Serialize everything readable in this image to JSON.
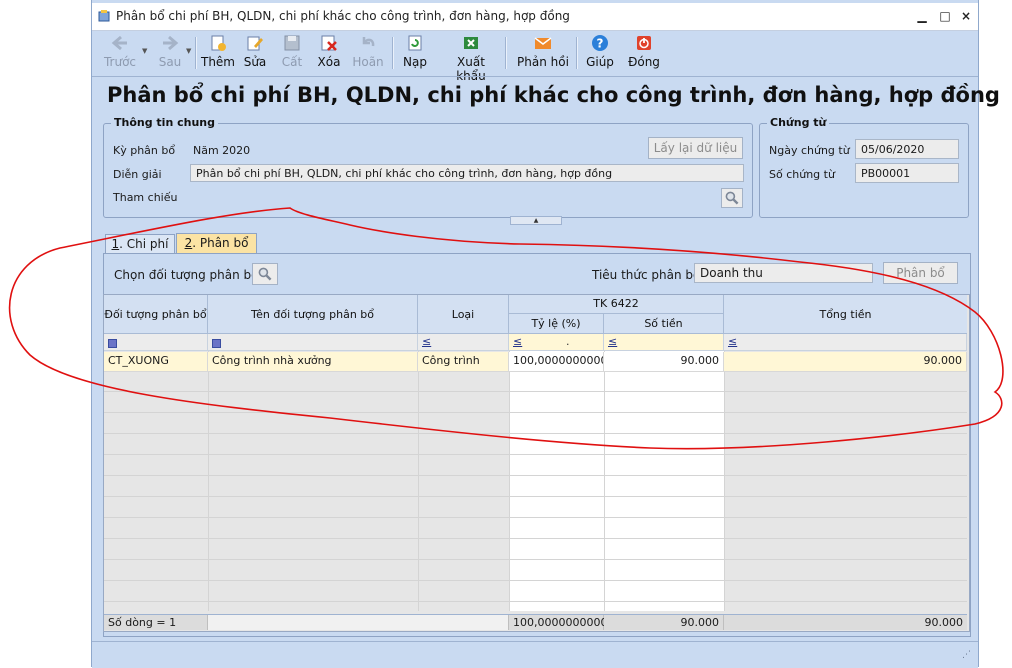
{
  "window": {
    "title": "Phân bổ chi phí BH, QLDN, chi phí khác cho công trình, đơn hàng, hợp đồng"
  },
  "toolbar": {
    "back": "Trước",
    "forward": "Sau",
    "add": "Thêm",
    "edit": "Sửa",
    "save": "Cất",
    "delete": "Xóa",
    "undo": "Hoãn",
    "reload": "Nạp",
    "export": "Xuất khẩu",
    "feedback": "Phản hồi",
    "help": "Giúp",
    "close": "Đóng"
  },
  "page_title": "Phân bổ chi phí BH, QLDN, chi phí khác cho công trình, đơn hàng, hợp đồng",
  "general_info": {
    "group_title": "Thông tin chung",
    "period_label": "Kỳ phân bổ",
    "period_value": "Năm 2020",
    "desc_label": "Diễn giải",
    "desc_value": "Phân bổ chi phí BH, QLDN, chi phí khác cho công trình, đơn hàng, hợp đồng",
    "ref_label": "Tham chiếu",
    "reload_data_button": "Lấy lại dữ liệu"
  },
  "voucher": {
    "group_title": "Chứng từ",
    "date_label": "Ngày chứng từ",
    "date_value": "05/06/2020",
    "number_label": "Số chứng từ",
    "number_value": "PB00001"
  },
  "tabs": [
    {
      "num": "1",
      "label": ". Chi phí"
    },
    {
      "num": "2",
      "label": ". Phân bổ"
    }
  ],
  "allocation": {
    "object_label": "Chọn đối tượng phân bổ",
    "criteria_label": "Tiêu thức phân bổ",
    "criteria_value": "Doanh thu",
    "allocate_button": "Phân bổ"
  },
  "grid": {
    "headers": {
      "object": "Đối tượng phân bổ",
      "object_name": "Tên đối tượng phân bổ",
      "type": "Loại",
      "account": "TK 6422",
      "ratio": "Tỷ lệ (%)",
      "amount": "Số tiền",
      "total": "Tổng tiền"
    },
    "filter_op": "≤",
    "filter_dot": ".",
    "rows": [
      {
        "object": "CT_XUONG",
        "object_name": "Công trình nhà xưởng",
        "type": "Công trình",
        "ratio": "100,0000000000",
        "amount": "90.000",
        "total": "90.000"
      }
    ],
    "footer": {
      "row_count": "Số dòng = 1",
      "ratio_total": "100,0000000000",
      "amount_total": "90.000",
      "total": "90.000"
    }
  },
  "colors": {
    "window_bg": "#c9daf1",
    "selected_row": "#fff7d6",
    "active_tab": "#fbe3a4",
    "annotation": "#e01010"
  }
}
